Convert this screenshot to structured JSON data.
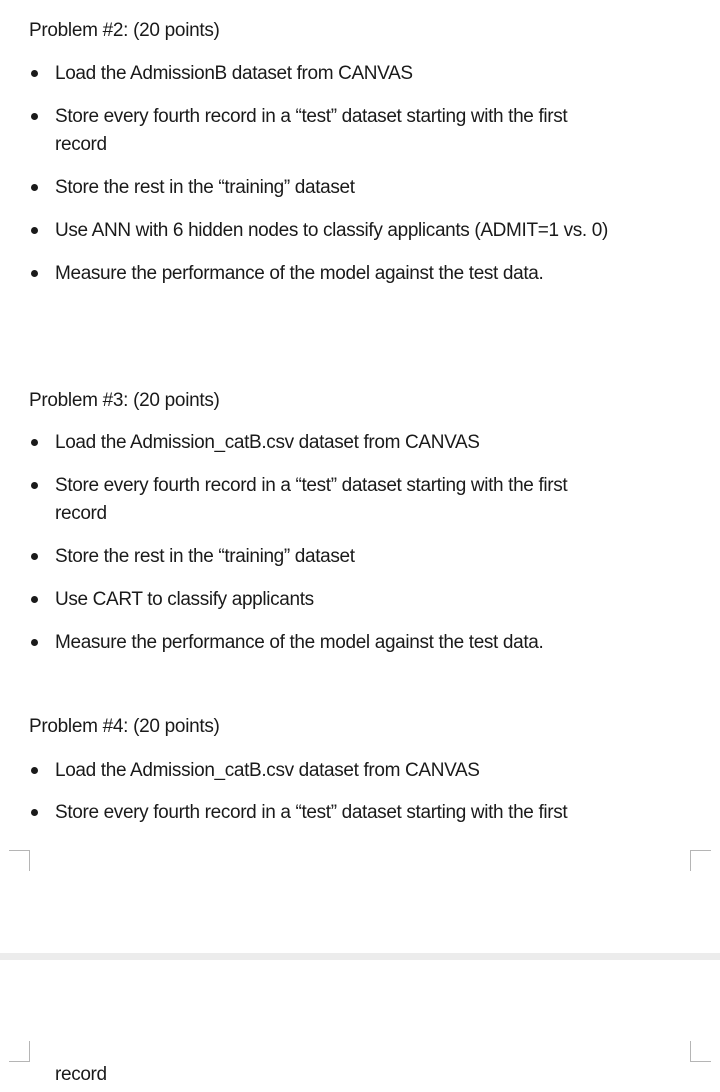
{
  "problems": [
    {
      "heading": "Problem #2: (20 points)",
      "items": [
        "Load the AdmissionB dataset from CANVAS",
        "Store every fourth record in a “test” dataset starting with the first",
        "record",
        "Store the rest in the “training” dataset",
        "Use ANN with 6 hidden nodes to classify applicants (ADMIT=1 vs. 0)",
        "Measure the performance of the model against the test data."
      ]
    },
    {
      "heading": "Problem #3: (20 points)",
      "items": [
        "Load the Admission_catB.csv dataset from CANVAS",
        "Store every fourth record in a “test” dataset starting with the first",
        "record",
        "Store the rest in the “training” dataset",
        "Use CART to classify applicants",
        "Measure the performance of the model against the test data."
      ]
    },
    {
      "heading": "Problem #4: (20 points)",
      "items": [
        "Load the Admission_catB.csv dataset from CANVAS",
        "Store every fourth record in a “test” dataset starting with the first",
        "record"
      ]
    }
  ]
}
